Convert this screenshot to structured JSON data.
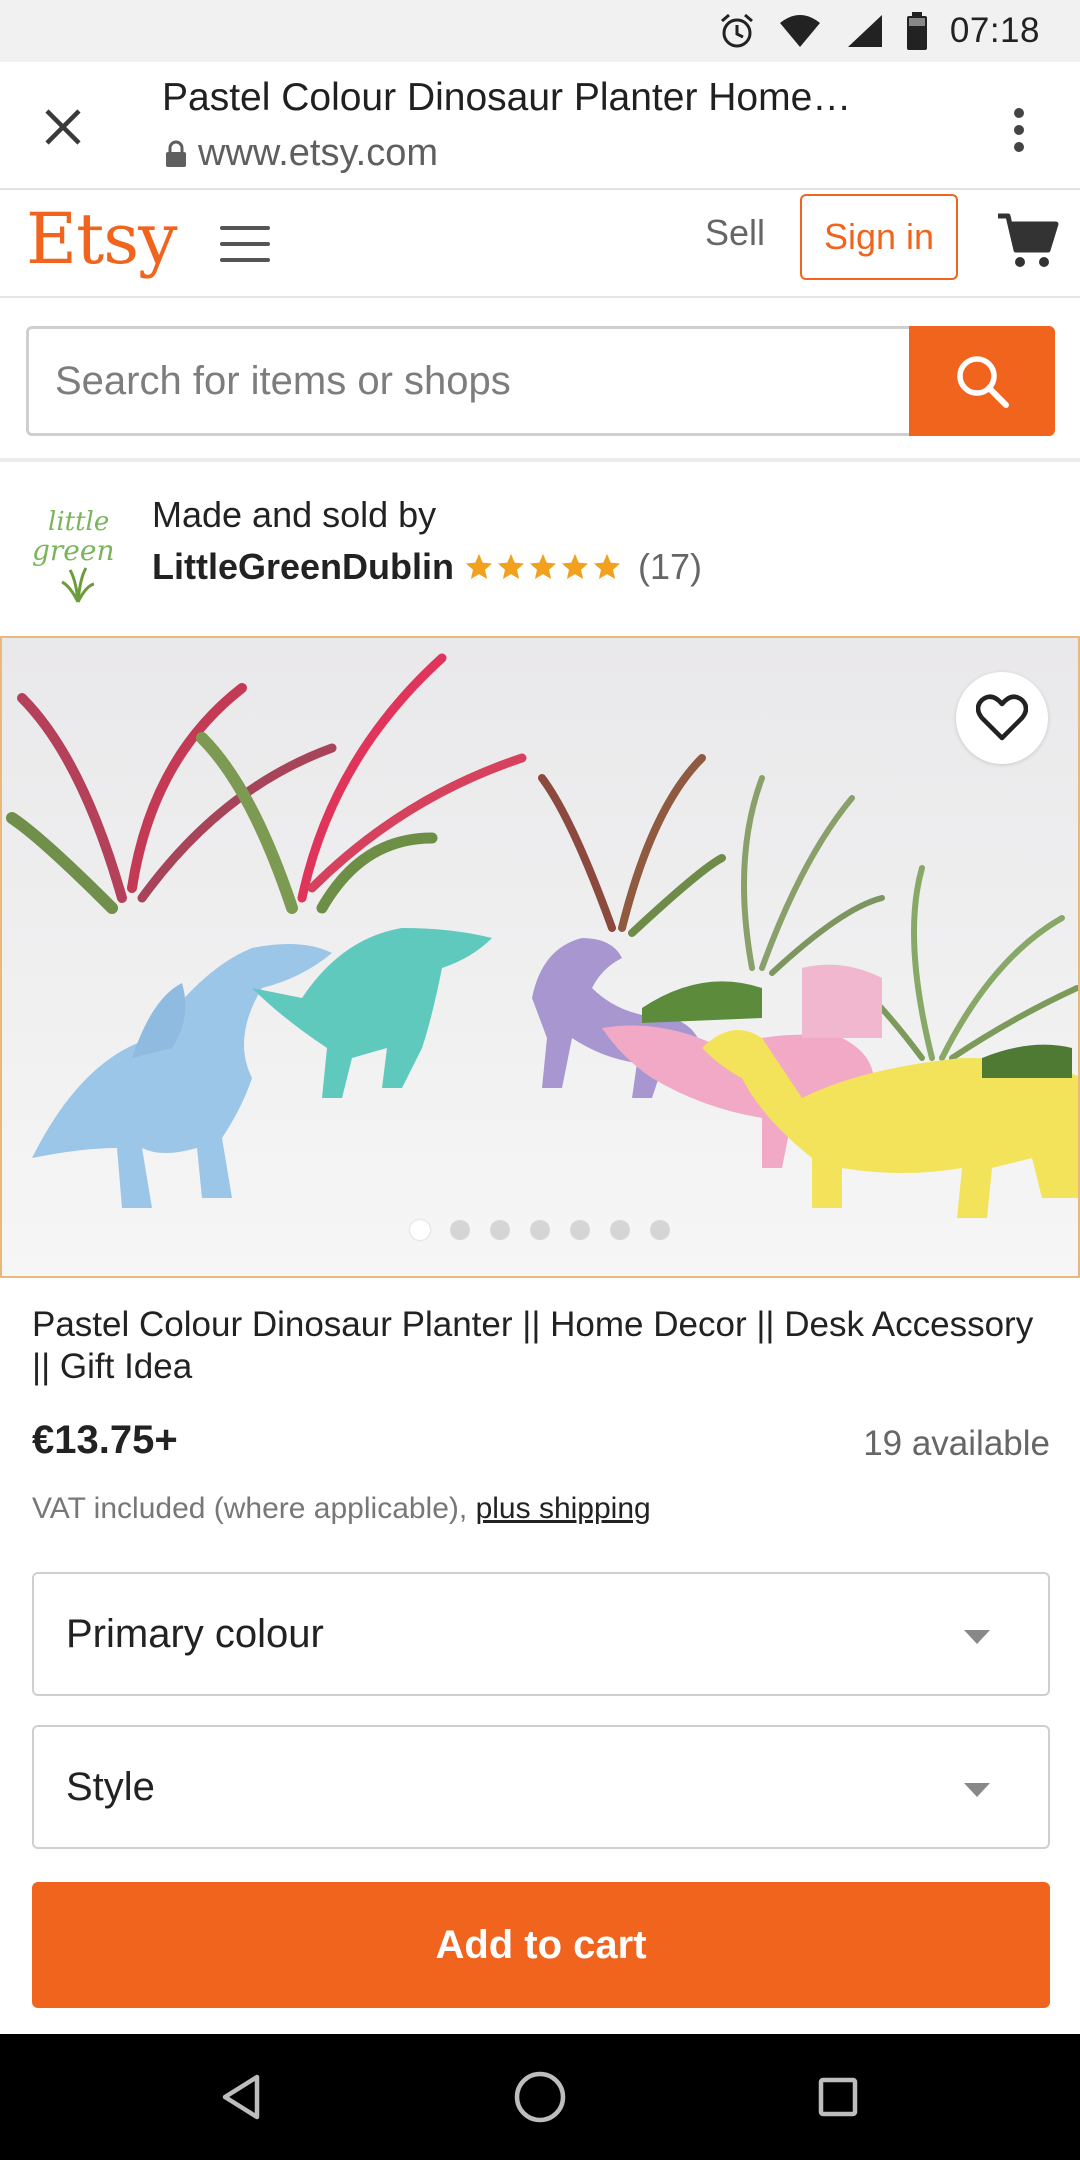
{
  "status_bar": {
    "time": "07:18"
  },
  "browser": {
    "tab_title": "Pastel Colour Dinosaur Planter Home…",
    "url": "www.etsy.com"
  },
  "header": {
    "logo": "Etsy",
    "sell_label": "Sell",
    "signin_label": "Sign in"
  },
  "search": {
    "placeholder": "Search for items or shops"
  },
  "shop": {
    "made_by": "Made and sold by",
    "name": "LittleGreenDublin",
    "rating": 5,
    "review_count": "(17)",
    "avatar_text": "little green"
  },
  "carousel": {
    "total_images": 7,
    "active_index": 0
  },
  "listing": {
    "title": "Pastel Colour Dinosaur Planter || Home Decor || Desk Accessory || Gift Idea",
    "price": "€13.75+",
    "available": "19 available",
    "vat_text": "VAT included (where applicable),",
    "shipping_link": "plus shipping"
  },
  "options": {
    "primary_colour": "Primary colour",
    "style": "Style"
  },
  "cta": {
    "add_to_cart": "Add to cart"
  },
  "colors": {
    "accent": "#f1641e",
    "star": "#f1a11b"
  }
}
